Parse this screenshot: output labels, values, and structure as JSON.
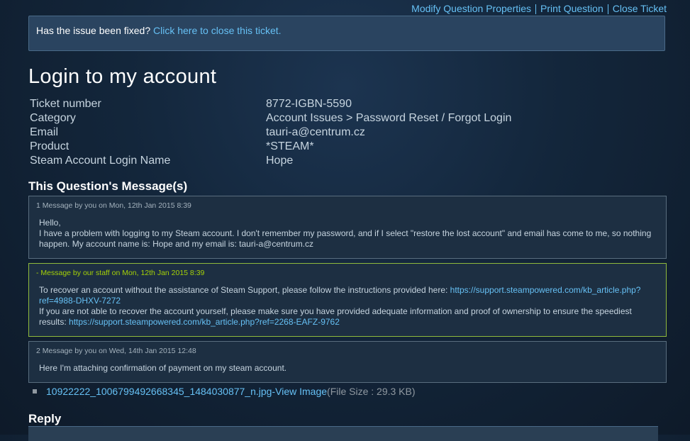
{
  "top_links": {
    "modify": "Modify Question Properties",
    "print": "Print Question",
    "close": "Close Ticket"
  },
  "notice": {
    "question": "Has the issue been fixed?",
    "link": "Click here to close this ticket."
  },
  "title": "Login to my account",
  "info": [
    {
      "label": "Ticket number",
      "value": "8772-IGBN-5590"
    },
    {
      "label": "Category",
      "value": "Account Issues > Password Reset / Forgot Login"
    },
    {
      "label": "Email",
      "value": "tauri-a@centrum.cz"
    },
    {
      "label": "Product",
      "value": "*STEAM*"
    },
    {
      "label": "Steam Account Login Name",
      "value": "Hope"
    }
  ],
  "messages_heading": "This Question's Message(s)",
  "messages": [
    {
      "header": "1  Message by you on Mon, 12th Jan 2015 8:39",
      "lines": [
        "Hello,",
        "I have a problem with logging to my Steam account. I don't remember my password, and if I select \"restore the lost account\" and email has come to me, so nothing happen. My account name is: Hope and my email is: tauri-a@centrum.cz"
      ]
    },
    {
      "header": "-  Message by our staff on Mon, 12th Jan 2015 8:39",
      "text1": "To recover an account without the assistance of Steam Support, please follow the instructions provided here: ",
      "link1": "https://support.steampowered.com/kb_article.php?ref=4988-DHXV-7272",
      "text2": "If you are not able to recover the account yourself, please make sure you have provided adequate information and proof of ownership to ensure the speediest results: ",
      "link2": "https://support.steampowered.com/kb_article.php?ref=2268-EAFZ-9762"
    },
    {
      "header": "2  Message by you on Wed, 14th Jan 2015 12:48",
      "lines": [
        "Here I'm attaching confirmation of payment on my steam account."
      ]
    }
  ],
  "attachment": {
    "filename": "10922222_1006799492668345_1484030877_n.jpg",
    "separator": " - ",
    "view": "View Image",
    "size": " (File Size : 29.3 KB)"
  },
  "reply_heading": "Reply"
}
